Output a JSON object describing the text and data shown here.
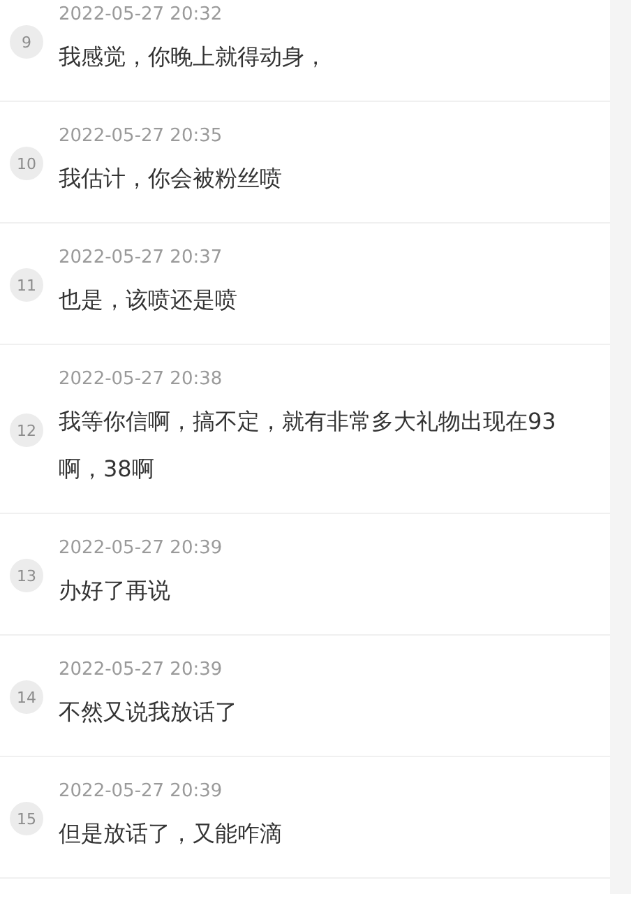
{
  "messages": [
    {
      "index": "9",
      "time": "2022-05-27 20:32",
      "text": "我感觉，你晚上就得动身，"
    },
    {
      "index": "10",
      "time": "2022-05-27 20:35",
      "text": "我估计，你会被粉丝喷"
    },
    {
      "index": "11",
      "time": "2022-05-27 20:37",
      "text": "也是，该喷还是喷"
    },
    {
      "index": "12",
      "time": "2022-05-27 20:38",
      "text": "我等你信啊，搞不定，就有非常多大礼物出现在93啊，38啊"
    },
    {
      "index": "13",
      "time": "2022-05-27 20:39",
      "text": "办好了再说"
    },
    {
      "index": "14",
      "time": "2022-05-27 20:39",
      "text": "不然又说我放话了"
    },
    {
      "index": "15",
      "time": "2022-05-27 20:39",
      "text": "但是放话了，又能咋滴"
    }
  ]
}
